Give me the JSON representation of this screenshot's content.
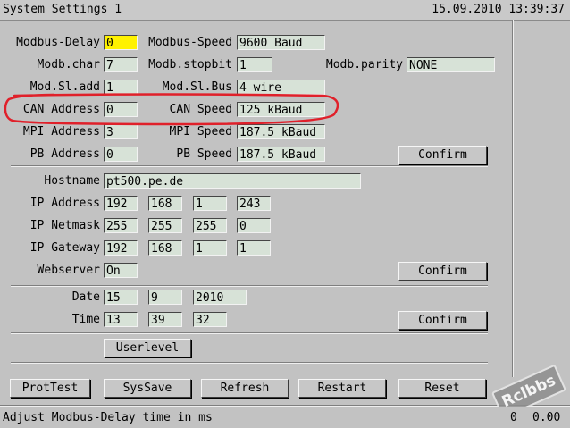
{
  "title": "System Settings 1",
  "datetime": "15.09.2010 13:39:37",
  "modbus": {
    "delay_label": "Modbus-Delay",
    "delay": "0",
    "speed_label": "Modbus-Speed",
    "speed": "9600 Baud",
    "char_label": "Modb.char",
    "char": "7",
    "stopbit_label": "Modb.stopbit",
    "stopbit": "1",
    "parity_label": "Modb.parity",
    "parity": "NONE",
    "sl_add_label": "Mod.Sl.add",
    "sl_add": "1",
    "sl_bus_label": "Mod.Sl.Bus",
    "sl_bus": "4 wire"
  },
  "can": {
    "address_label": "CAN Address",
    "address": "0",
    "speed_label": "CAN Speed",
    "speed": "125 kBaud"
  },
  "mpi": {
    "address_label": "MPI Address",
    "address": "3",
    "speed_label": "MPI Speed",
    "speed": "187.5 kBaud"
  },
  "pb": {
    "address_label": "PB Address",
    "address": "0",
    "speed_label": "PB Speed",
    "speed": "187.5 kBaud"
  },
  "confirm1": "Confirm",
  "network": {
    "hostname_label": "Hostname",
    "hostname": "pt500.pe.de",
    "ip_label": "IP Address",
    "ip": [
      "192",
      "168",
      "1",
      "243"
    ],
    "mask_label": "IP Netmask",
    "mask": [
      "255",
      "255",
      "255",
      "0"
    ],
    "gw_label": "IP Gateway",
    "gw": [
      "192",
      "168",
      "1",
      "1"
    ],
    "web_label": "Webserver",
    "web": "On",
    "confirm": "Confirm"
  },
  "datetime_set": {
    "date_label": "Date",
    "date": [
      "15",
      "9",
      "2010"
    ],
    "time_label": "Time",
    "time": [
      "13",
      "39",
      "32"
    ],
    "confirm": "Confirm"
  },
  "userlevel": "Userlevel",
  "buttons": [
    "ProtTest",
    "SysSave",
    "Refresh",
    "Restart",
    "Reset"
  ],
  "status": {
    "text": "Adjust Modbus-Delay time in ms",
    "value_a": "0",
    "value_b": "0.00"
  },
  "watermark": "Rclbbs",
  "annotation_color": "#e0202a",
  "active_field_color": "#fff200"
}
